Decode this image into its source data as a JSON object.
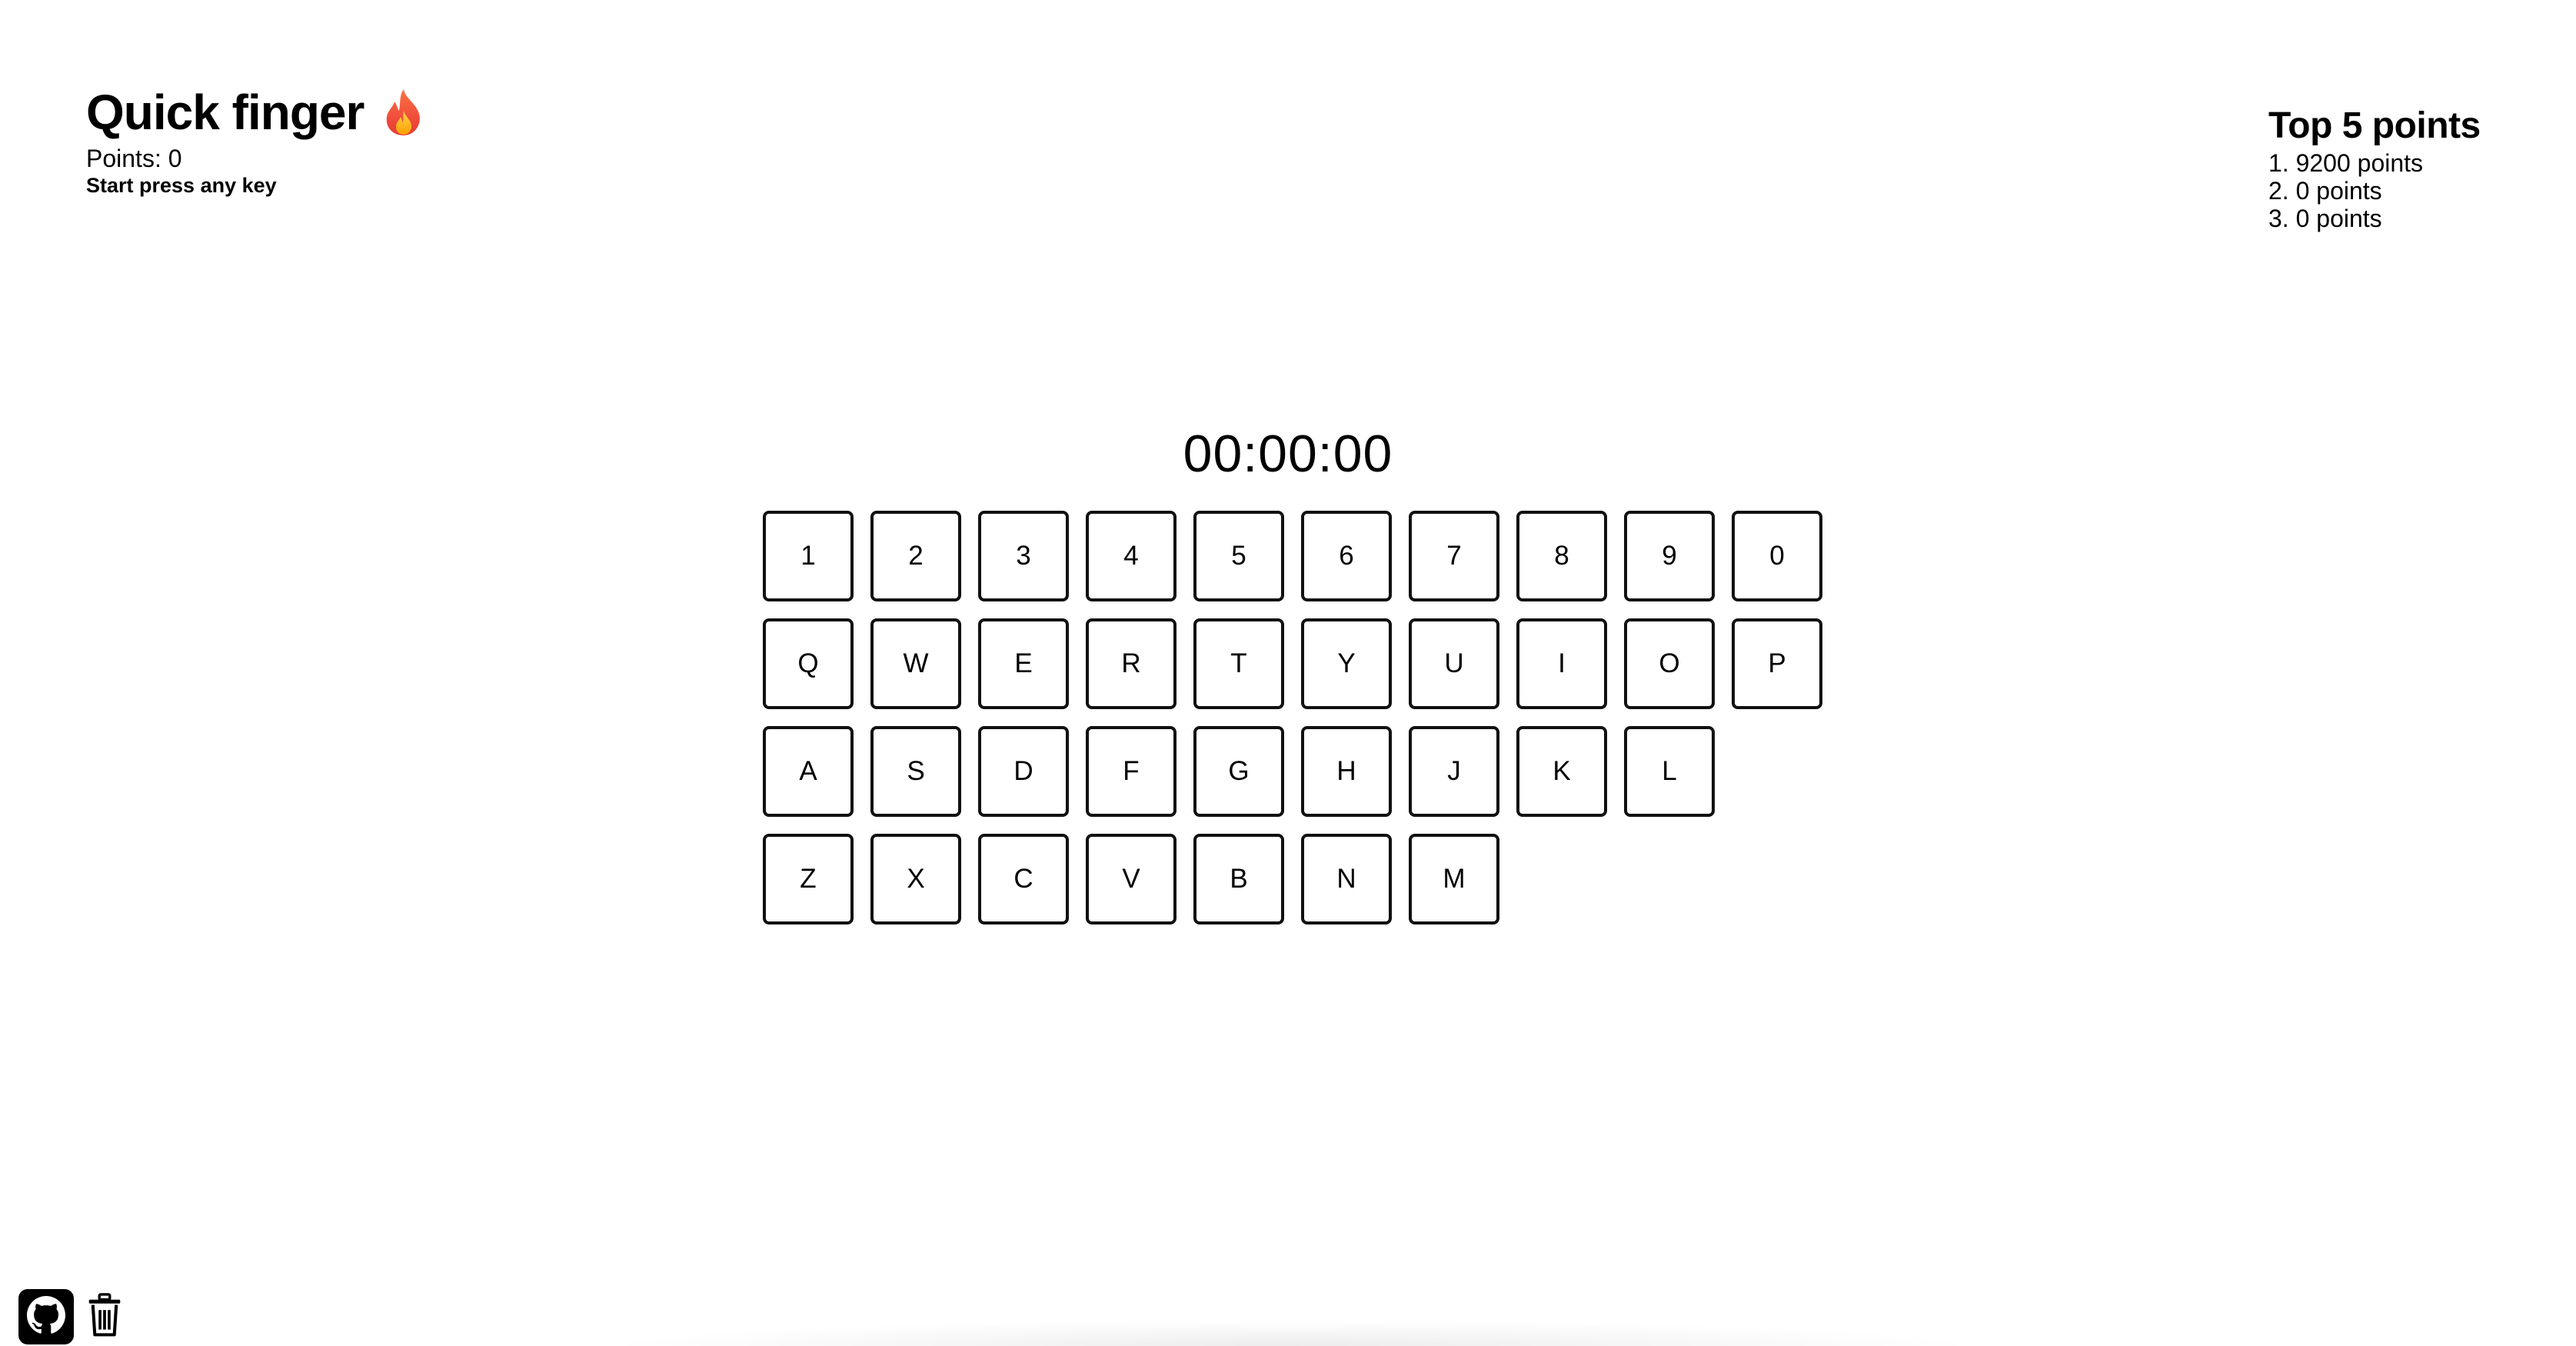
{
  "header": {
    "title": "Quick finger",
    "title_icon": "flame-icon",
    "points_text": "Points: 0",
    "hint": "Start press any key"
  },
  "leaderboard": {
    "title": "Top 5 points",
    "items": [
      "1. 9200 points",
      "2. 0 points",
      "3. 0 points"
    ]
  },
  "timer": "00:00:00",
  "keyboard": {
    "rows": [
      [
        "1",
        "2",
        "3",
        "4",
        "5",
        "6",
        "7",
        "8",
        "9",
        "0"
      ],
      [
        "Q",
        "W",
        "E",
        "R",
        "T",
        "Y",
        "U",
        "I",
        "O",
        "P"
      ],
      [
        "A",
        "S",
        "D",
        "F",
        "G",
        "H",
        "J",
        "K",
        "L"
      ],
      [
        "Z",
        "X",
        "C",
        "V",
        "B",
        "N",
        "M"
      ]
    ]
  },
  "footer": {
    "icons": [
      "github-icon",
      "trash-icon"
    ]
  },
  "colors": {
    "key_border": "#111111",
    "background": "#ffffff",
    "flame": "#f4511e"
  }
}
